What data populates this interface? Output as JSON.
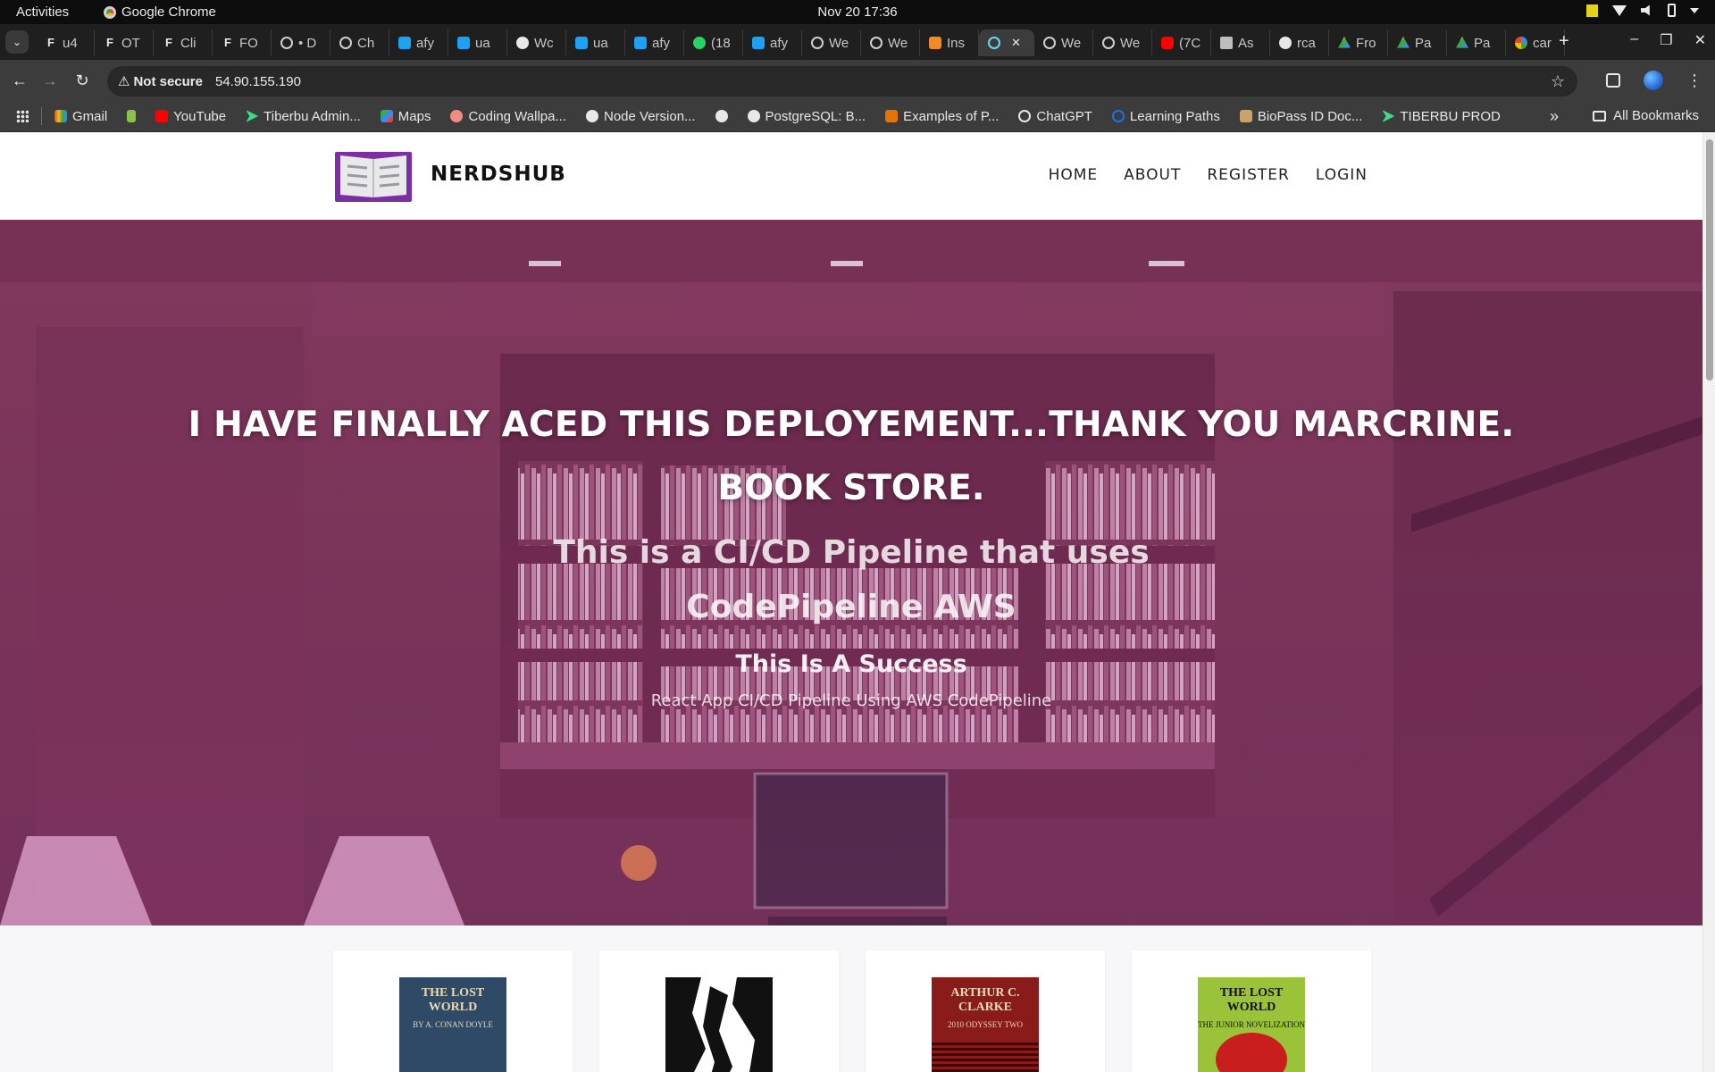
{
  "os": {
    "activities": "Activities",
    "app_name": "Google Chrome",
    "clock": "Nov 20  17:36"
  },
  "browser": {
    "tabs": [
      {
        "label": "u4",
        "icon": "f-icon"
      },
      {
        "label": "OT",
        "icon": "f-icon"
      },
      {
        "label": "Cli",
        "icon": "f-icon"
      },
      {
        "label": "FO",
        "icon": "f-icon"
      },
      {
        "label": "• D",
        "icon": "circle-icon"
      },
      {
        "label": "Ch",
        "icon": "chatgpt-icon"
      },
      {
        "label": "afy",
        "icon": "blue-icon"
      },
      {
        "label": "ua",
        "icon": "blue-icon"
      },
      {
        "label": "Wc",
        "icon": "github-icon"
      },
      {
        "label": "ua",
        "icon": "blue-icon"
      },
      {
        "label": "afy",
        "icon": "blue-icon"
      },
      {
        "label": "(18",
        "icon": "whatsapp-icon"
      },
      {
        "label": "afy",
        "icon": "blue-icon"
      },
      {
        "label": "We",
        "icon": "circle-icon"
      },
      {
        "label": "We",
        "icon": "circle-icon"
      },
      {
        "label": "Ins",
        "icon": "orange-icon"
      },
      {
        "label": "",
        "icon": "react-icon",
        "active": true
      },
      {
        "label": "We",
        "icon": "circle-icon"
      },
      {
        "label": "We",
        "icon": "circle-icon"
      },
      {
        "label": "(7C",
        "icon": "youtube-icon"
      },
      {
        "label": "As",
        "icon": "image-icon"
      },
      {
        "label": "rca",
        "icon": "github-icon"
      },
      {
        "label": "Fro",
        "icon": "drive-icon"
      },
      {
        "label": "Pa",
        "icon": "drive-icon"
      },
      {
        "label": "Pa",
        "icon": "drive-icon"
      },
      {
        "label": "car",
        "icon": "google-icon"
      }
    ],
    "omnibox": {
      "security": "Not secure",
      "url": "54.90.155.190"
    },
    "bookmarks": [
      {
        "label": "Gmail",
        "icon": "gmail-icon"
      },
      {
        "label": "",
        "icon": "green-icon"
      },
      {
        "label": "YouTube",
        "icon": "youtube-icon"
      },
      {
        "label": "Tiberbu Admin...",
        "icon": "arrow-icon"
      },
      {
        "label": "Maps",
        "icon": "maps-icon"
      },
      {
        "label": "Coding Wallpa...",
        "icon": "mask-icon"
      },
      {
        "label": "Node Version...",
        "icon": "node-icon"
      },
      {
        "label": "",
        "icon": "node-icon"
      },
      {
        "label": "PostgreSQL: B...",
        "icon": "pg-icon"
      },
      {
        "label": "Examples of P...",
        "icon": "stack-icon"
      },
      {
        "label": "ChatGPT",
        "icon": "chatgpt-icon"
      },
      {
        "label": "Learning Paths",
        "icon": "learning-icon"
      },
      {
        "label": "BioPass ID Doc...",
        "icon": "bio-icon"
      },
      {
        "label": "TIBERBU PROD",
        "icon": "arrow-icon"
      }
    ],
    "all_bookmarks": "All Bookmarks"
  },
  "site": {
    "brand": "NERDSHUB",
    "nav": [
      "HOME",
      "ABOUT",
      "REGISTER",
      "LOGIN"
    ],
    "hero": {
      "headline": "I HAVE FINALLY ACED THIS DEPLOYEMENT...THANK YOU MARCRINE.",
      "store": "BOOK STORE.",
      "pipeline_line1": "This is a CI/CD Pipeline that uses",
      "pipeline_line2": "CodePipeline AWS",
      "success": "This Is A Success",
      "subtitle": "React App CI/CD Pipeline Using AWS CodePipeline"
    },
    "books": [
      {
        "cover_text": "THE LOST WORLD",
        "cover_sub": "BY A. CONAN DOYLE",
        "color": "#2e4a66"
      },
      {
        "cover_text": "",
        "cover_sub": "",
        "color": "#111111"
      },
      {
        "cover_text": "ARTHUR C. CLARKE",
        "cover_sub": "2010 ODYSSEY TWO",
        "color": "#8a1b1b"
      },
      {
        "cover_text": "THE LOST WORLD",
        "cover_sub": "THE JUNIOR NOVELIZATION",
        "color": "#9bc33a"
      }
    ]
  }
}
